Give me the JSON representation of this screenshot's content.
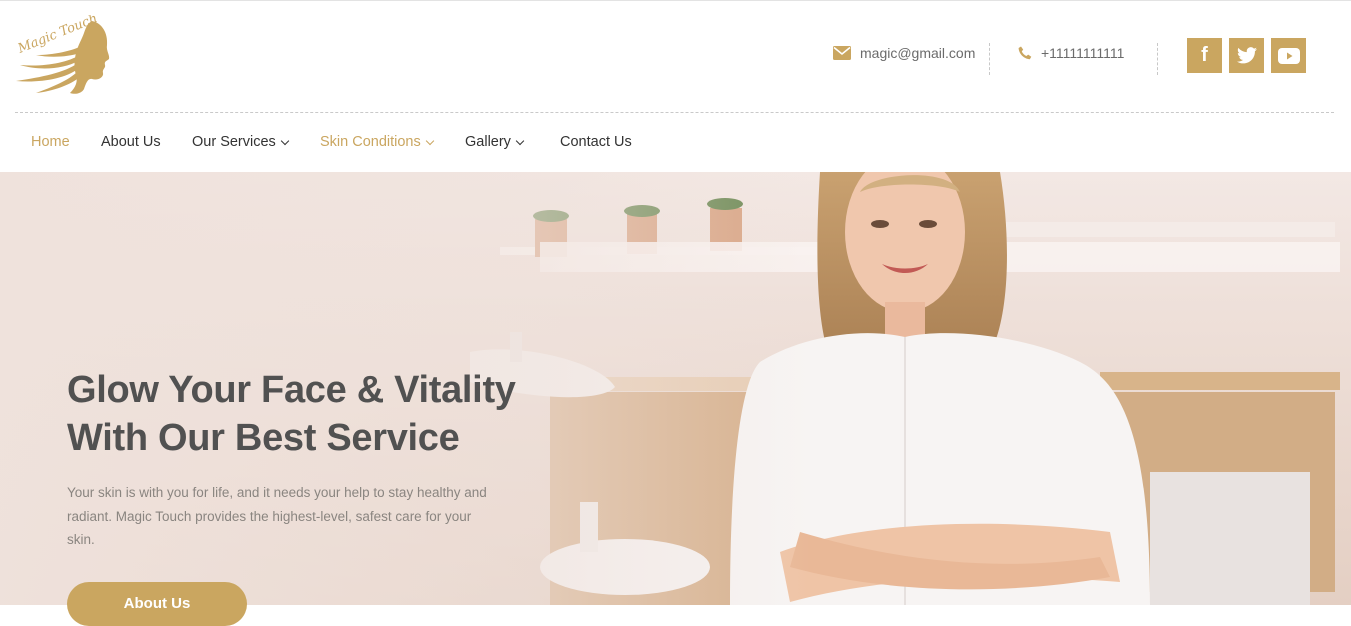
{
  "brand": {
    "logo_text": "Magic Touch"
  },
  "header": {
    "email": "magic@gmail.com",
    "phone": "+11111111111",
    "social": [
      {
        "name": "facebook",
        "icon": "facebook-icon",
        "glyph": "f"
      },
      {
        "name": "twitter",
        "icon": "twitter-icon"
      },
      {
        "name": "youtube",
        "icon": "youtube-icon"
      }
    ]
  },
  "nav": {
    "items": [
      {
        "label": "Home",
        "active": true,
        "dropdown": false
      },
      {
        "label": "About Us",
        "active": false,
        "dropdown": false
      },
      {
        "label": "Our Services",
        "active": false,
        "dropdown": true
      },
      {
        "label": "Skin Conditions",
        "active": true,
        "dropdown": true
      },
      {
        "label": "Gallery",
        "active": false,
        "dropdown": true
      },
      {
        "label": "Contact Us",
        "active": false,
        "dropdown": false
      }
    ]
  },
  "hero": {
    "title_line1": "Glow Your Face & Vitality",
    "title_line2": "With Our Best Service",
    "text": "Your skin is with you for life, and it needs your help to stay healthy and radiant. Magic Touch provides the highest-level, safest care for your skin.",
    "button_label": "About Us"
  },
  "colors": {
    "accent": "#caa660",
    "heading": "#515151",
    "body_text": "#8a8580"
  }
}
